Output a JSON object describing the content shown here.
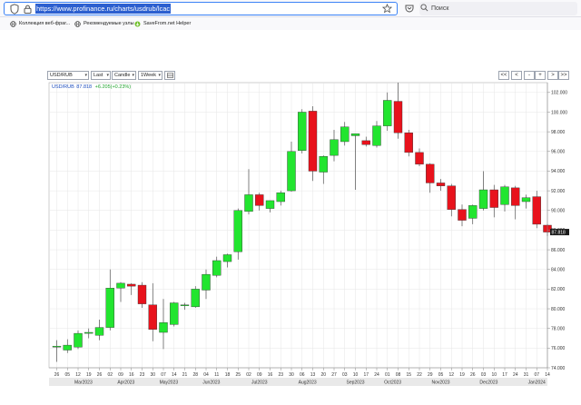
{
  "browser": {
    "url": "https://www.profinance.ru/charts/usdrub/lcac",
    "search_placeholder": "Поиск"
  },
  "bookmarks": [
    {
      "label": "Коллекция веб-фраг..."
    },
    {
      "label": "Рекомендуемые узлы"
    },
    {
      "label": "SaveFrom.net Helper"
    }
  ],
  "controls": {
    "symbol": "USD/RUB",
    "price_type": "Last",
    "chart_type": "Candle",
    "period": "1Week",
    "nav": [
      "<<",
      "<",
      "-",
      "+",
      ">",
      ">>"
    ]
  },
  "chart_data": {
    "type": "candlestick",
    "legend": {
      "symbol": "USD/RUB",
      "last": "87.818",
      "change": "+6.205(+0.23%)"
    },
    "last_price_label": "87.818",
    "ylim": [
      74.0,
      103.0
    ],
    "y_ticks": [
      74,
      76,
      78,
      80,
      82,
      84,
      86,
      88,
      90,
      92,
      94,
      96,
      98,
      100,
      102
    ],
    "y_tick_labels": [
      "74.000",
      "76.000",
      "78.000",
      "80.000",
      "82.000",
      "84.000",
      "86.000",
      "88.000",
      "90.000",
      "92.000",
      "94.000",
      "96.000",
      "98.000",
      "100.000",
      "102.000"
    ],
    "x_labels": [
      "26",
      "05",
      "12",
      "19",
      "26",
      "02",
      "09",
      "16",
      "23",
      "30",
      "07",
      "14",
      "21",
      "28",
      "04",
      "11",
      "18",
      "25",
      "02",
      "09",
      "16",
      "23",
      "30",
      "06",
      "13",
      "20",
      "27",
      "03",
      "10",
      "17",
      "24",
      "01",
      "08",
      "15",
      "22",
      "29",
      "05",
      "12",
      "19",
      "26",
      "03",
      "10",
      "17",
      "24",
      "31",
      "07",
      "14"
    ],
    "months": [
      {
        "label": "Mar2023",
        "at": 2.5
      },
      {
        "label": "Apr2023",
        "at": 6.5
      },
      {
        "label": "May2023",
        "at": 10.5
      },
      {
        "label": "Jun2023",
        "at": 14.5
      },
      {
        "label": "Jul2023",
        "at": 19
      },
      {
        "label": "Aug2023",
        "at": 23.5
      },
      {
        "label": "Sep2023",
        "at": 28
      },
      {
        "label": "Oct2023",
        "at": 31.5
      },
      {
        "label": "Nov2023",
        "at": 36
      },
      {
        "label": "Dec2023",
        "at": 40.5
      },
      {
        "label": "Jan2024",
        "at": 45
      }
    ],
    "colors": {
      "up": "#22e52f",
      "down": "#e8121c",
      "grid": "#e6e6e6"
    },
    "candles": [
      {
        "o": 76.1,
        "h": 76.8,
        "l": 74.6,
        "c": 76.2
      },
      {
        "o": 75.8,
        "h": 76.9,
        "l": 75.5,
        "c": 76.3
      },
      {
        "o": 76.1,
        "h": 77.8,
        "l": 75.9,
        "c": 77.5
      },
      {
        "o": 77.5,
        "h": 78.0,
        "l": 77.0,
        "c": 77.6
      },
      {
        "o": 77.3,
        "h": 78.9,
        "l": 76.8,
        "c": 78.1
      },
      {
        "o": 78.1,
        "h": 84.0,
        "l": 77.8,
        "c": 82.1
      },
      {
        "o": 82.1,
        "h": 82.7,
        "l": 80.7,
        "c": 82.6
      },
      {
        "o": 82.5,
        "h": 82.6,
        "l": 81.4,
        "c": 82.3
      },
      {
        "o": 82.4,
        "h": 82.7,
        "l": 80.1,
        "c": 80.5
      },
      {
        "o": 80.4,
        "h": 82.6,
        "l": 76.7,
        "c": 77.9
      },
      {
        "o": 77.6,
        "h": 81.0,
        "l": 75.9,
        "c": 78.6
      },
      {
        "o": 78.4,
        "h": 80.7,
        "l": 78.2,
        "c": 80.6
      },
      {
        "o": 80.3,
        "h": 80.6,
        "l": 79.9,
        "c": 80.4
      },
      {
        "o": 80.2,
        "h": 82.3,
        "l": 80.1,
        "c": 82.0
      },
      {
        "o": 81.9,
        "h": 84.0,
        "l": 81.0,
        "c": 83.5
      },
      {
        "o": 83.4,
        "h": 85.3,
        "l": 83.2,
        "c": 84.9
      },
      {
        "o": 84.8,
        "h": 85.6,
        "l": 84.2,
        "c": 85.5
      },
      {
        "o": 85.8,
        "h": 90.2,
        "l": 85.0,
        "c": 90.0
      },
      {
        "o": 89.9,
        "h": 94.2,
        "l": 89.6,
        "c": 91.6
      },
      {
        "o": 91.6,
        "h": 91.8,
        "l": 90.0,
        "c": 90.5
      },
      {
        "o": 90.2,
        "h": 91.0,
        "l": 89.8,
        "c": 91.0
      },
      {
        "o": 90.9,
        "h": 92.0,
        "l": 90.5,
        "c": 91.8
      },
      {
        "o": 92.0,
        "h": 97.0,
        "l": 91.9,
        "c": 96.0
      },
      {
        "o": 96.1,
        "h": 100.3,
        "l": 95.8,
        "c": 100.0
      },
      {
        "o": 100.1,
        "h": 100.6,
        "l": 93.0,
        "c": 94.0
      },
      {
        "o": 93.9,
        "h": 95.6,
        "l": 92.7,
        "c": 95.5
      },
      {
        "o": 95.6,
        "h": 98.2,
        "l": 95.0,
        "c": 97.2
      },
      {
        "o": 97.0,
        "h": 99.0,
        "l": 96.6,
        "c": 98.5
      },
      {
        "o": 97.6,
        "h": 97.8,
        "l": 92.1,
        "c": 97.8
      },
      {
        "o": 97.1,
        "h": 97.5,
        "l": 96.5,
        "c": 96.7
      },
      {
        "o": 96.6,
        "h": 99.1,
        "l": 96.4,
        "c": 98.6
      },
      {
        "o": 98.6,
        "h": 102.0,
        "l": 98.1,
        "c": 101.2
      },
      {
        "o": 101.1,
        "h": 103.0,
        "l": 97.3,
        "c": 97.9
      },
      {
        "o": 97.9,
        "h": 98.2,
        "l": 95.5,
        "c": 95.9
      },
      {
        "o": 95.9,
        "h": 96.3,
        "l": 94.5,
        "c": 94.7
      },
      {
        "o": 94.7,
        "h": 94.8,
        "l": 91.8,
        "c": 92.8
      },
      {
        "o": 92.8,
        "h": 93.2,
        "l": 92.0,
        "c": 92.5
      },
      {
        "o": 92.5,
        "h": 92.7,
        "l": 89.4,
        "c": 90.1
      },
      {
        "o": 90.1,
        "h": 90.6,
        "l": 88.4,
        "c": 89.0
      },
      {
        "o": 89.2,
        "h": 90.6,
        "l": 88.6,
        "c": 90.5
      },
      {
        "o": 90.2,
        "h": 94.0,
        "l": 90.0,
        "c": 92.1
      },
      {
        "o": 92.1,
        "h": 92.6,
        "l": 89.3,
        "c": 90.3
      },
      {
        "o": 90.6,
        "h": 92.6,
        "l": 89.9,
        "c": 92.4
      },
      {
        "o": 92.3,
        "h": 92.5,
        "l": 89.1,
        "c": 90.5
      },
      {
        "o": 90.9,
        "h": 91.6,
        "l": 90.2,
        "c": 91.3
      },
      {
        "o": 91.4,
        "h": 92.0,
        "l": 88.2,
        "c": 88.6
      },
      {
        "o": 88.5,
        "h": 88.6,
        "l": 87.4,
        "c": 87.8
      }
    ]
  }
}
